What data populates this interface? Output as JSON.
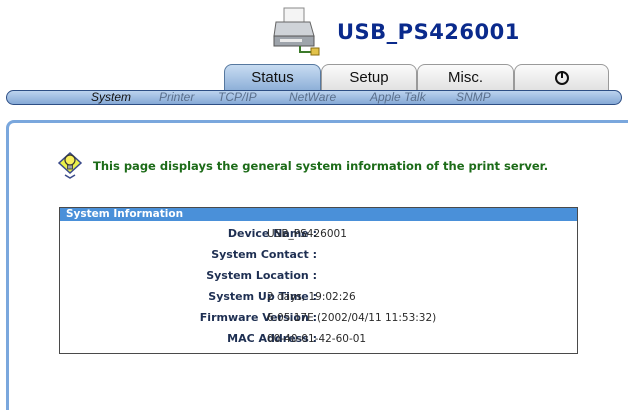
{
  "header": {
    "device_name": "USB_PS426001",
    "icon": "printer-icon"
  },
  "tabs": [
    {
      "label": "Status",
      "active": true
    },
    {
      "label": "Setup",
      "active": false
    },
    {
      "label": "Misc.",
      "active": false
    },
    {
      "label": "",
      "icon": "power-icon",
      "active": false
    }
  ],
  "subnav": [
    {
      "label": "System",
      "active": true
    },
    {
      "label": "Printer",
      "active": false
    },
    {
      "label": "TCP/IP",
      "active": false
    },
    {
      "label": "NetWare",
      "active": false
    },
    {
      "label": "Apple Talk",
      "active": false
    },
    {
      "label": "SNMP",
      "active": false
    }
  ],
  "main": {
    "info_icon": "lightbulb-info-icon",
    "info_message": "This page displays the general system information of the print server.",
    "system_info": {
      "title": "System Information",
      "rows": [
        {
          "label": "Device Name :",
          "value": "USB_PS426001"
        },
        {
          "label": "System Contact :",
          "value": ""
        },
        {
          "label": "System Location :",
          "value": ""
        },
        {
          "label": "System Up Time :",
          "value": "2 days, 19:02:26"
        },
        {
          "label": "Firmware Version :",
          "value": "6.05.17E (2002/04/11 11:53:32)"
        },
        {
          "label": "MAC Address :",
          "value": "00-40-01-42-60-01"
        }
      ]
    }
  },
  "colors": {
    "title": "#0a2a8c",
    "message": "#1c6b18",
    "box_header": "#4a90d9",
    "panel_border": "#7aa7dd"
  }
}
